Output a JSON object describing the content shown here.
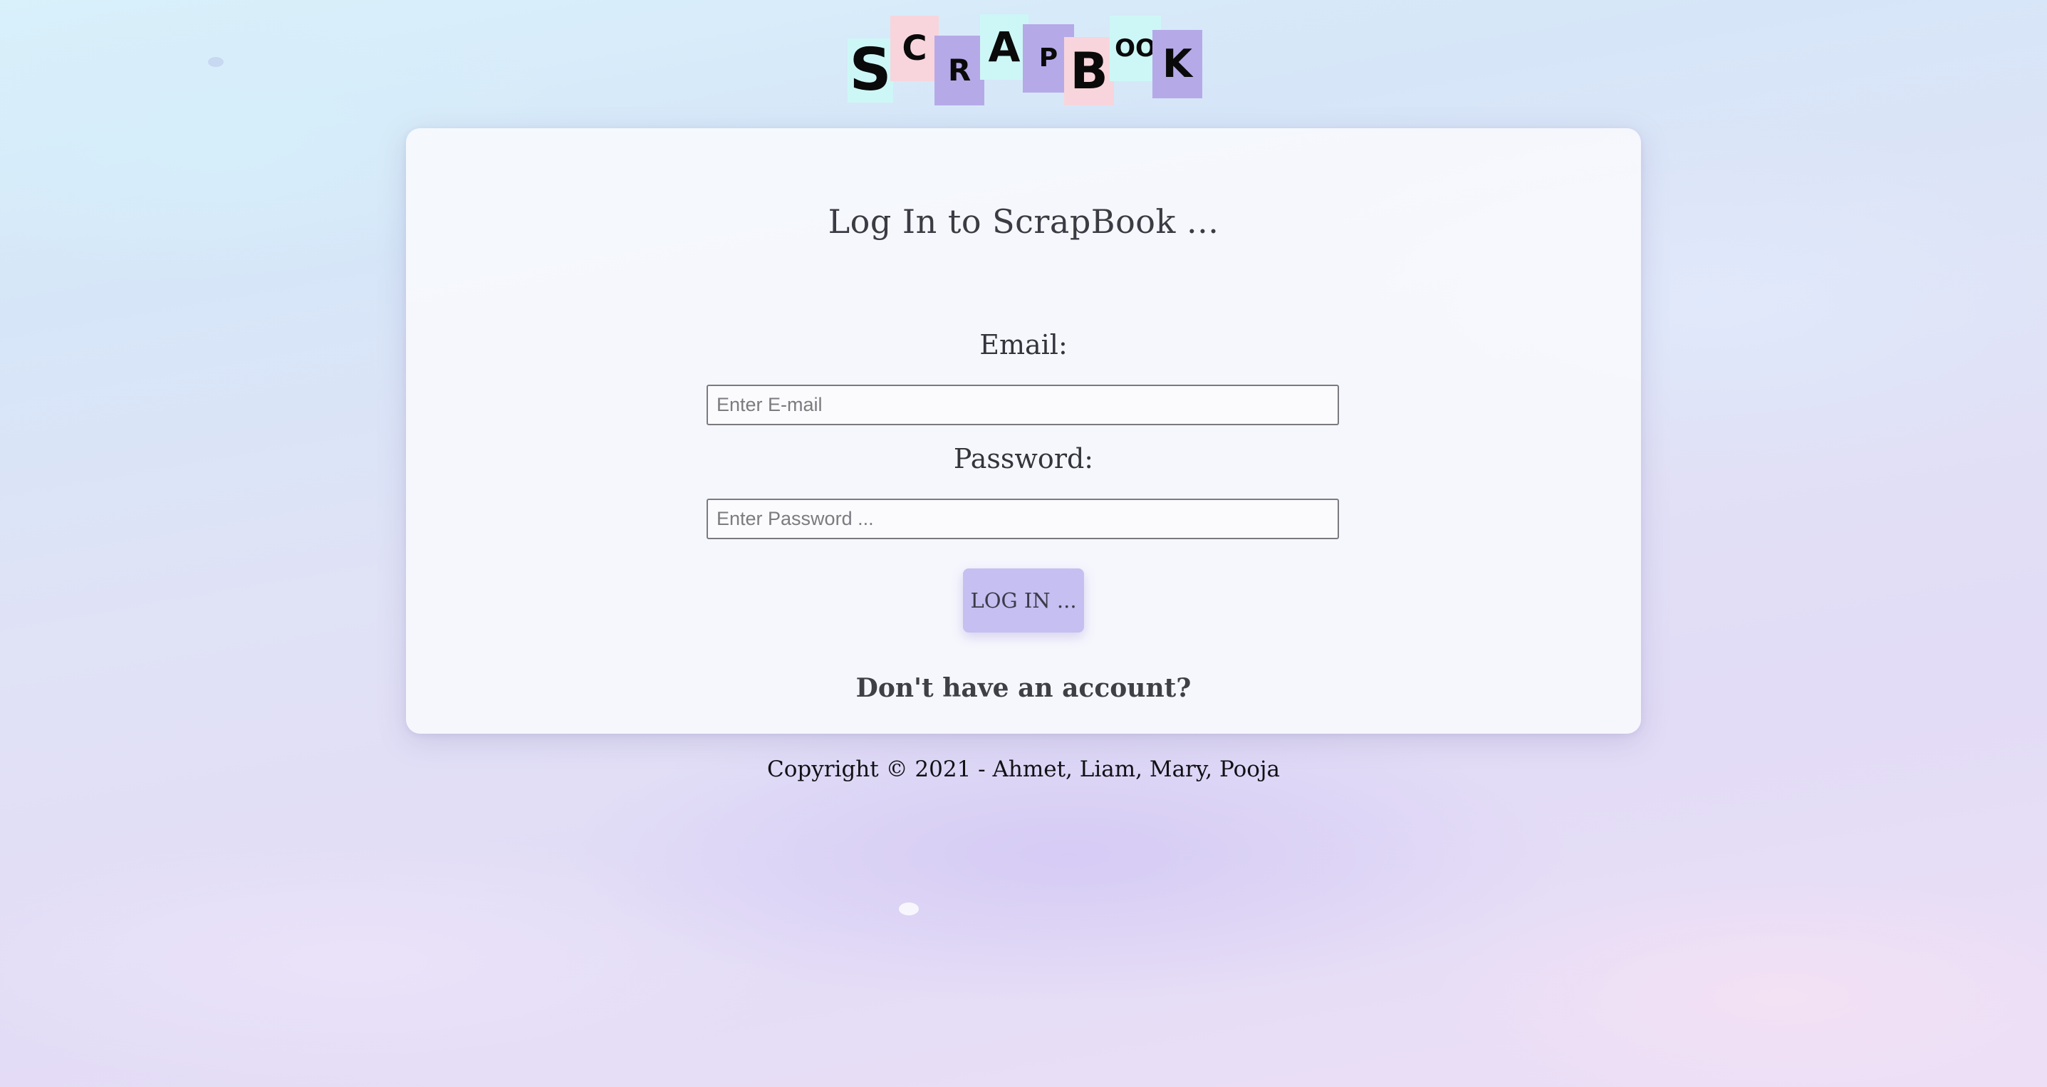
{
  "logo": {
    "letters": [
      "S",
      "C",
      "R",
      "A",
      "P",
      "B",
      "O",
      "O",
      "K"
    ],
    "colors": {
      "cyan": "#cdf7f6",
      "pink": "#f8d5dc",
      "purple": "#b6a9e8"
    }
  },
  "login_form": {
    "title": "Log In to ScrapBook ...",
    "email_label": "Email:",
    "email_placeholder": "Enter E-mail",
    "email_value": "",
    "password_label": "Password:",
    "password_placeholder": "Enter Password ...",
    "password_value": "",
    "submit_label": "LOG IN ...",
    "signup_prompt": "Don't have an account?"
  },
  "footer": {
    "copyright": "Copyright © 2021 - Ahmet, Liam, Mary, Pooja"
  },
  "theme": {
    "button_color": "#c6bff1",
    "card_color": "#f8f9fd",
    "text_color": "#3b3b44"
  }
}
